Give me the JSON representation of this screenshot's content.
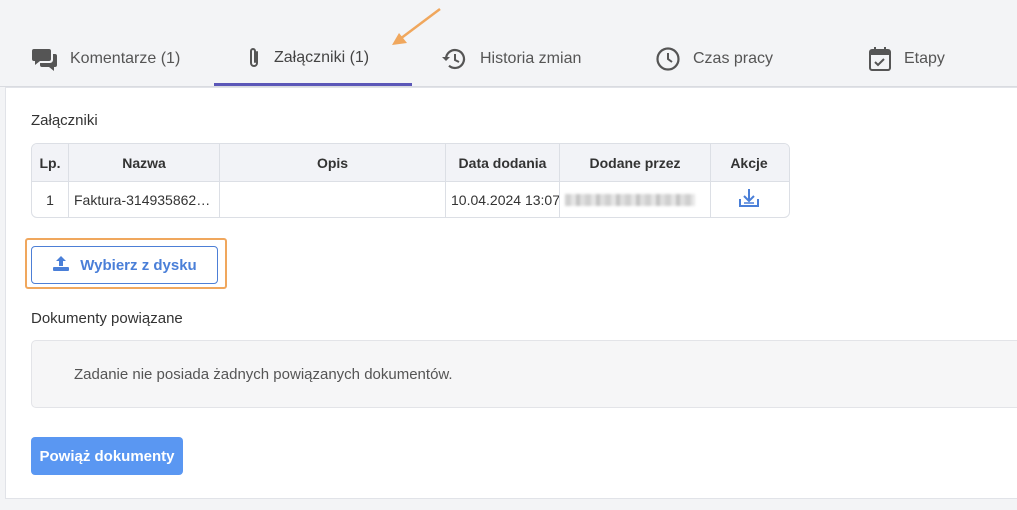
{
  "tabs": [
    {
      "label": "Komentarze (1)",
      "icon": "comments-icon"
    },
    {
      "label": "Załączniki (1)",
      "icon": "paperclip-icon"
    },
    {
      "label": "Historia zmian",
      "icon": "history-icon"
    },
    {
      "label": "Czas pracy",
      "icon": "clock-icon"
    },
    {
      "label": "Etapy",
      "icon": "calendar-check-icon"
    }
  ],
  "attachments": {
    "title": "Załączniki",
    "columns": [
      "Lp.",
      "Nazwa",
      "Opis",
      "Data dodania",
      "Dodane przez",
      "Akcje"
    ],
    "rows": [
      {
        "lp": "1",
        "name": "Faktura-314935862…",
        "description": "",
        "date": "10.04.2024 13:07",
        "added_by": "",
        "action_icon": "download-icon"
      }
    ],
    "upload_button": "Wybierz z dysku"
  },
  "related_documents": {
    "title": "Dokumenty powiązane",
    "empty_message": "Zadanie nie posiada żadnych powiązanych dokumentów.",
    "link_button": "Powiąż dokumenty"
  },
  "colors": {
    "accent": "#5b57b8",
    "primary_button": "#5a97f2",
    "annotation": "#f0a75d"
  }
}
